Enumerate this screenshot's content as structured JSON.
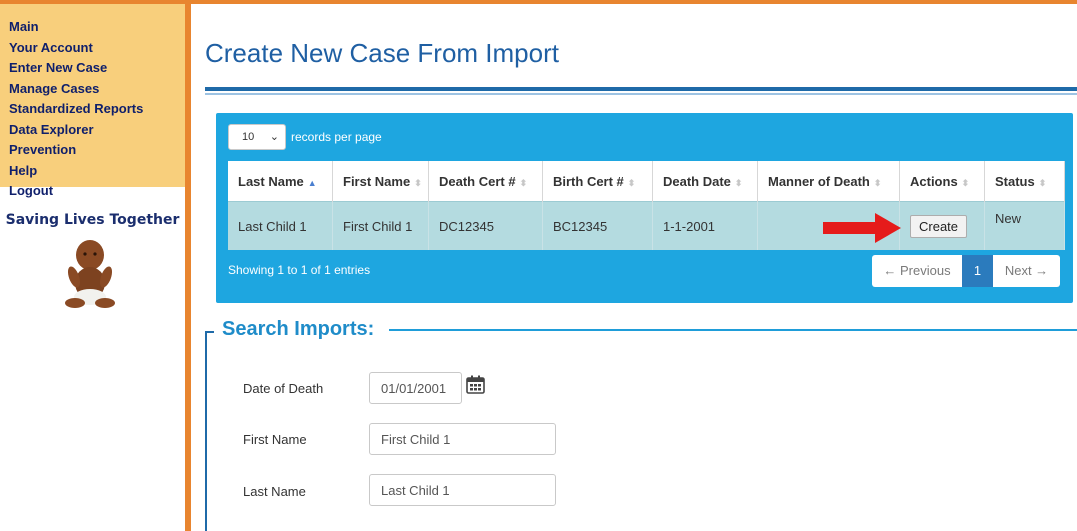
{
  "sidebar": {
    "items": [
      {
        "label": "Main"
      },
      {
        "label": "Your Account"
      },
      {
        "label": "Enter New Case"
      },
      {
        "label": "Manage Cases"
      },
      {
        "label": "Standardized Reports"
      },
      {
        "label": "Data Explorer"
      },
      {
        "label": "Prevention"
      },
      {
        "label": "Help"
      },
      {
        "label": "Logout"
      }
    ],
    "tagline": "Saving Lives Together"
  },
  "page": {
    "title": "Create New Case From Import"
  },
  "table": {
    "page_length": "10",
    "page_length_label": "records per page",
    "columns": [
      "Last Name",
      "First Name",
      "Death Cert #",
      "Birth Cert #",
      "Death Date",
      "Manner of Death",
      "Actions",
      "Status"
    ],
    "rows": [
      {
        "last_name": "Last Child 1",
        "first_name": "First Child 1",
        "death_cert": "DC12345",
        "birth_cert": "BC12345",
        "death_date": "1-1-2001",
        "manner_of_death": "",
        "action": "Create",
        "status": "New"
      }
    ],
    "info": "Showing 1 to 1 of 1 entries",
    "pager": {
      "prev": "← Previous",
      "current": "1",
      "next": "Next →"
    }
  },
  "search": {
    "title": "Search Imports:",
    "date_of_death_label": "Date of Death",
    "date_of_death_value": "01/01/2001",
    "first_name_label": "First Name",
    "first_name_value": "First Child 1",
    "last_name_label": "Last Name",
    "last_name_value": "Last Child 1"
  },
  "colors": {
    "accent": "#1ea6e0",
    "sidebar": "#f8cf7c",
    "border": "#e8852f",
    "title": "#1f5fa3",
    "arrow": "#e51b1b"
  },
  "icons": {
    "calendar": "calendar-icon",
    "arrow": "red-arrow-icon"
  }
}
